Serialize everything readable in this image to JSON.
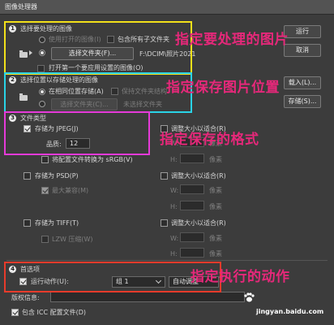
{
  "window": {
    "title": "图像处理器"
  },
  "section1": {
    "label": "选择要处理的图像",
    "option_open": "使用打开的图像(I)",
    "include_sub": "包含所有子文件夹",
    "select_folder_btn": "选择文件夹(F)...",
    "path": "F:\\DCIM\\照片2021",
    "open_first": "打开第一个要应用设置的图像(O)"
  },
  "section2": {
    "label": "选择位置以存储处理的图像",
    "same_location": "在相同位置存储(A)",
    "keep_structure": "保持文件夹结构",
    "select_folder_btn": "选择文件夹(C)...",
    "no_folder": "未选择文件夹"
  },
  "section3": {
    "label": "文件类型",
    "save_jpeg": "存储为 JPEG(J)",
    "resize_fit": "调整大小以适合(R)",
    "quality_label": "品质:",
    "quality_value": "12",
    "convert_srgb": "将配置文件转换为 sRGB(V)",
    "w_label": "W:",
    "h_label": "H:",
    "px": "像素",
    "save_psd": "存储为 PSD(P)",
    "max_compat": "最大兼容(M)",
    "save_tiff": "存储为 TIFF(T)",
    "lzw": "LZW 压缩(W)"
  },
  "section4": {
    "label": "首选项",
    "run_action": "运行动作(U):",
    "action_set": "组 1",
    "action_name": "自动调整",
    "copyright": "版权信息:",
    "include_icc": "包含 ICC 配置文件(D)"
  },
  "buttons": {
    "run": "运行",
    "cancel": "取消",
    "load": "载入(L)...",
    "save": "存储(S)..."
  },
  "annotations": {
    "a1": "指定要处理的图片",
    "a2": "指定保存图片位置",
    "a3": "指定保存的格式",
    "a4": "指定执行的动作"
  },
  "watermark": {
    "text": "jingyan.baidu.com"
  },
  "colors": {
    "frame1": "#f2e01a",
    "frame2": "#2ad3e6",
    "frame3": "#e63ad9",
    "frame4": "#e83b2b",
    "annotation": "#e6287a"
  }
}
